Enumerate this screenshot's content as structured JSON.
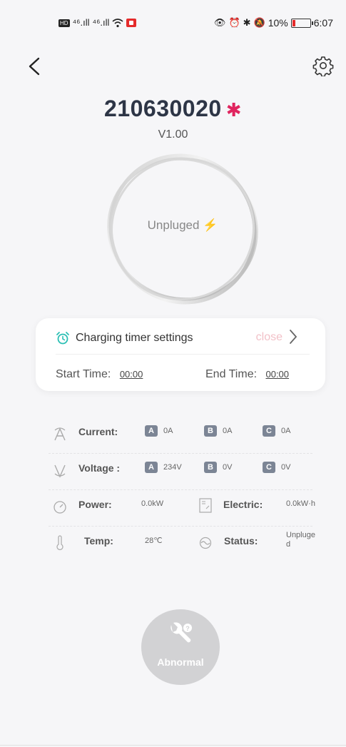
{
  "status_bar": {
    "signal_1": "⁴⁶.ıll",
    "signal_2": "⁴⁶.ıll",
    "battery_pct": "10%",
    "time": "6:07",
    "battery_level": 0.1
  },
  "header": {
    "device_id": "210630020",
    "version": "V1.00"
  },
  "charger": {
    "status_label": "Unpluged"
  },
  "timer": {
    "title": "Charging timer settings",
    "state": "close",
    "start_label": "Start Time:",
    "start_value": "00:00",
    "end_label": "End Time:",
    "end_value": "00:00"
  },
  "stats": {
    "current": {
      "label": "Current:",
      "phases": [
        {
          "phase": "A",
          "value": "0A"
        },
        {
          "phase": "B",
          "value": "0A"
        },
        {
          "phase": "C",
          "value": "0A"
        }
      ]
    },
    "voltage": {
      "label": "Voltage :",
      "phases": [
        {
          "phase": "A",
          "value": "234V"
        },
        {
          "phase": "B",
          "value": "0V"
        },
        {
          "phase": "C",
          "value": "0V"
        }
      ]
    },
    "power": {
      "label": "Power:",
      "value": "0.0kW"
    },
    "electric": {
      "label": "Electric:",
      "value": "0.0kW·h"
    },
    "temp": {
      "label": "Temp:",
      "value": "28℃"
    },
    "status": {
      "label": "Status:",
      "value": "Unpluge d"
    }
  },
  "abnormal": {
    "label": "Abnormal"
  },
  "colors": {
    "bluetooth": "#e0245e",
    "badge": "#7c8595",
    "timer_icon": "#2bbfb4",
    "close_text": "#f2c1c8"
  }
}
